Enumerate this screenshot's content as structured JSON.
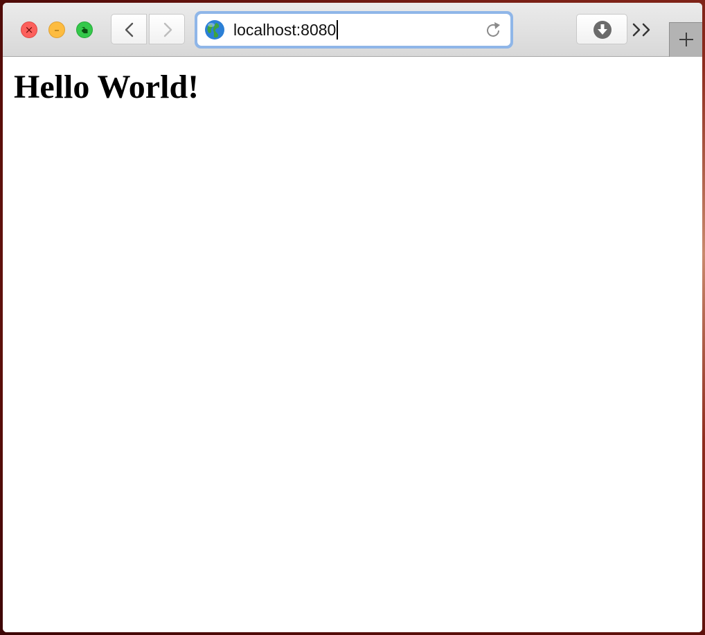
{
  "browser": {
    "window_controls": {
      "close_glyph": "×",
      "minimize_glyph": "–"
    },
    "icons": {
      "back": "chevron-left-icon",
      "forward": "chevron-right-icon",
      "site": "globe-icon",
      "reload": "reload-icon",
      "downloads": "download-icon",
      "overflow": "double-chevron-right-icon",
      "new_tab": "plus-icon"
    },
    "address_bar": {
      "value": "localhost:8080",
      "focus_ring_color": "#8fb6e8"
    },
    "overflow_label": "»"
  },
  "page": {
    "heading": "Hello World!"
  },
  "colors": {
    "close": "#fc605c",
    "minimize": "#fdbc40",
    "zoom": "#34c84a",
    "toolbar": "#dedede",
    "content_background": "#ffffff"
  }
}
